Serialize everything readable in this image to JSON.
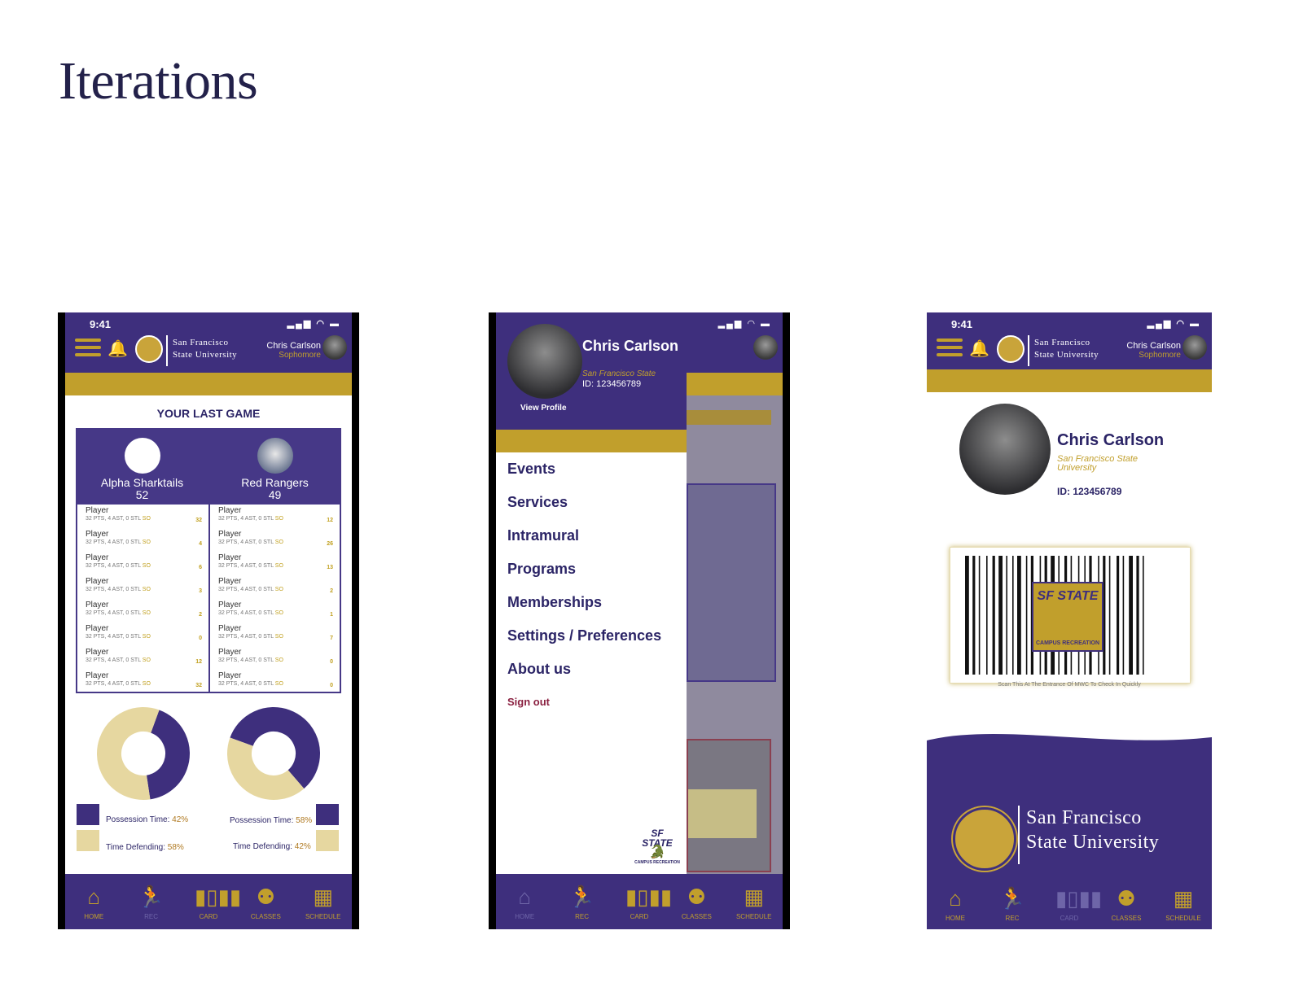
{
  "page": {
    "title": "Iterations"
  },
  "status": {
    "time": "9:41"
  },
  "header": {
    "university_line1": "San Francisco",
    "university_line2": "State University",
    "user_name": "Chris Carlson",
    "user_year": "Sophomore"
  },
  "tabs": [
    {
      "label": "HOME",
      "icon": "home-icon"
    },
    {
      "label": "REC",
      "icon": "running-figures-icon"
    },
    {
      "label": "CARD",
      "icon": "barcode-icon"
    },
    {
      "label": "CLASSES",
      "icon": "group-icon"
    },
    {
      "label": "SCHEDULE",
      "icon": "calendar-icon"
    }
  ],
  "game": {
    "heading": "YOUR LAST GAME",
    "team_a": {
      "name": "Alpha Sharktails",
      "score": "52"
    },
    "team_b": {
      "name": "Red Rangers",
      "score": "49"
    },
    "roster_a": [
      {
        "name": "Player",
        "stats": "32 PTS, 4 AST, 0 STL",
        "tag": "SO",
        "pts": "32"
      },
      {
        "name": "Player",
        "stats": "32 PTS, 4 AST, 0 STL",
        "tag": "SO",
        "pts": "4"
      },
      {
        "name": "Player",
        "stats": "32 PTS, 4 AST, 0 STL",
        "tag": "SO",
        "pts": "6"
      },
      {
        "name": "Player",
        "stats": "32 PTS, 4 AST, 0 STL",
        "tag": "SO",
        "pts": "3"
      },
      {
        "name": "Player",
        "stats": "32 PTS, 4 AST, 0 STL",
        "tag": "SO",
        "pts": "2"
      },
      {
        "name": "Player",
        "stats": "32 PTS, 4 AST, 0 STL",
        "tag": "SO",
        "pts": "0"
      },
      {
        "name": "Player",
        "stats": "32 PTS, 4 AST, 0 STL",
        "tag": "SO",
        "pts": "12"
      },
      {
        "name": "Player",
        "stats": "32 PTS, 4 AST, 0 STL",
        "tag": "SO",
        "pts": "32"
      }
    ],
    "roster_b": [
      {
        "name": "Player",
        "stats": "32 PTS, 4 AST, 0 STL",
        "tag": "SO",
        "pts": "12"
      },
      {
        "name": "Player",
        "stats": "32 PTS, 4 AST, 0 STL",
        "tag": "SO",
        "pts": "26"
      },
      {
        "name": "Player",
        "stats": "32 PTS, 4 AST, 0 STL",
        "tag": "SO",
        "pts": "13"
      },
      {
        "name": "Player",
        "stats": "32 PTS, 4 AST, 0 STL",
        "tag": "SO",
        "pts": "2"
      },
      {
        "name": "Player",
        "stats": "32 PTS, 4 AST, 0 STL",
        "tag": "SO",
        "pts": "1"
      },
      {
        "name": "Player",
        "stats": "32 PTS, 4 AST, 0 STL",
        "tag": "SO",
        "pts": "7"
      },
      {
        "name": "Player",
        "stats": "32 PTS, 4 AST, 0 STL",
        "tag": "SO",
        "pts": "0"
      },
      {
        "name": "Player",
        "stats": "32 PTS, 4 AST, 0 STL",
        "tag": "SO",
        "pts": "0"
      }
    ],
    "stats_a": {
      "possession_label": "Possession Time:",
      "possession_value": "42%",
      "defending_label": "Time Defending:",
      "defending_value": "58%"
    },
    "stats_b": {
      "possession_label": "Possession Time:",
      "possession_value": "58%",
      "defending_label": "Time Defending:",
      "defending_value": "42%"
    }
  },
  "drawer": {
    "name": "Chris Carlson",
    "university": "San Francisco State",
    "id": "ID: 123456789",
    "view_profile": "View Profile",
    "items": [
      "Events",
      "Services",
      "Intramural",
      "Programs",
      "Memberships",
      "Settings / Preferences",
      "About us"
    ],
    "sign_out": "Sign out",
    "logo_text": "SF STATE",
    "logo_sub": "CAMPUS RECREATION"
  },
  "card": {
    "name": "Chris Carlson",
    "university": "San Francisco State University",
    "id": "ID: 123456789",
    "badge_text": "SF STATE",
    "badge_sub": "CAMPUS RECREATION",
    "scan_note": "Scan This At The Entrance Of MWC To Check In Quickly"
  },
  "chart_data": [
    {
      "type": "pie",
      "labels": [
        "Possession Time",
        "Time Defending"
      ],
      "values": [
        42,
        58
      ]
    },
    {
      "type": "pie",
      "labels": [
        "Possession Time",
        "Time Defending"
      ],
      "values": [
        58,
        42
      ]
    }
  ],
  "colors": {
    "purple": "#3e2f7d",
    "gold": "#c19f2c",
    "beige": "#e6d7a0"
  }
}
